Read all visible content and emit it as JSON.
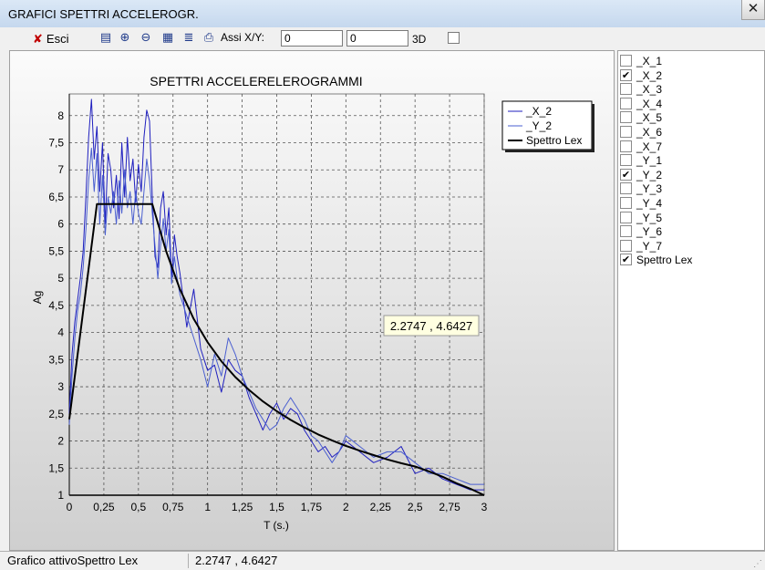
{
  "window": {
    "title": "GRAFICI SPETTRI ACCELEROGR.",
    "close_glyph": "✕"
  },
  "toolbar": {
    "exit_label": "Esci",
    "axes_label": "Assi X/Y:",
    "axis_x_value": "0",
    "axis_y_value": "0",
    "label_3d": "3D",
    "icons": [
      "save-icon",
      "zoom-in-icon",
      "zoom-out-icon",
      "copy-icon",
      "layers-icon",
      "print-icon"
    ]
  },
  "series_list": [
    {
      "label": "_X_1",
      "checked": false
    },
    {
      "label": "_X_2",
      "checked": true
    },
    {
      "label": "_X_3",
      "checked": false
    },
    {
      "label": "_X_4",
      "checked": false
    },
    {
      "label": "_X_5",
      "checked": false
    },
    {
      "label": "_X_6",
      "checked": false
    },
    {
      "label": "_X_7",
      "checked": false
    },
    {
      "label": "_Y_1",
      "checked": false
    },
    {
      "label": "_Y_2",
      "checked": true
    },
    {
      "label": "_Y_3",
      "checked": false
    },
    {
      "label": "_Y_4",
      "checked": false
    },
    {
      "label": "_Y_5",
      "checked": false
    },
    {
      "label": "_Y_6",
      "checked": false
    },
    {
      "label": "_Y_7",
      "checked": false
    },
    {
      "label": "Spettro Lex",
      "checked": true
    }
  ],
  "status": {
    "active_chart": "Grafico attivoSpettro Lex",
    "coords": "2.2747 , 4.6427"
  },
  "chart_data": {
    "type": "line",
    "title": "SPETTRI ACCELERELEROGRAMMI",
    "xlabel": "T (s.)",
    "ylabel": "Ag",
    "xlim": [
      0,
      3
    ],
    "ylim": [
      1,
      8.4
    ],
    "x_ticks": [
      0,
      0.25,
      0.5,
      0.75,
      1,
      1.25,
      1.5,
      1.75,
      2,
      2.25,
      2.5,
      2.75,
      3
    ],
    "x_tick_labels": [
      "0",
      "0,25",
      "0,5",
      "0,75",
      "1",
      "1,25",
      "1,5",
      "1,75",
      "2",
      "2,25",
      "2,5",
      "2,75",
      "3"
    ],
    "y_ticks": [
      1,
      1.5,
      2,
      2.5,
      3,
      3.5,
      4,
      4.5,
      5,
      5.5,
      6,
      6.5,
      7,
      7.5,
      8
    ],
    "y_tick_labels": [
      "1",
      "1,5",
      "2",
      "2,5",
      "3",
      "3,5",
      "4",
      "4,5",
      "5",
      "5,5",
      "6",
      "6,5",
      "7",
      "7,5",
      "8"
    ],
    "grid": true,
    "legend_position": "top-right",
    "tooltip": "2.2747 , 4.6427",
    "series": [
      {
        "name": "_X_2",
        "color": "#1f1fbf",
        "x": [
          0,
          0.02,
          0.04,
          0.06,
          0.08,
          0.1,
          0.12,
          0.14,
          0.16,
          0.18,
          0.2,
          0.22,
          0.24,
          0.26,
          0.28,
          0.3,
          0.32,
          0.34,
          0.36,
          0.38,
          0.4,
          0.42,
          0.44,
          0.46,
          0.48,
          0.5,
          0.52,
          0.54,
          0.56,
          0.58,
          0.6,
          0.62,
          0.64,
          0.66,
          0.68,
          0.7,
          0.72,
          0.74,
          0.76,
          0.78,
          0.8,
          0.85,
          0.9,
          0.95,
          1,
          1.05,
          1.1,
          1.15,
          1.2,
          1.25,
          1.3,
          1.35,
          1.4,
          1.45,
          1.5,
          1.55,
          1.6,
          1.65,
          1.7,
          1.75,
          1.8,
          1.85,
          1.9,
          1.95,
          2,
          2.1,
          2.2,
          2.3,
          2.4,
          2.5,
          2.6,
          2.7,
          2.8,
          2.9,
          3
        ],
        "values": [
          2.5,
          3.6,
          4.2,
          4.6,
          5.0,
          5.5,
          6.5,
          7.6,
          8.3,
          7.2,
          7.8,
          6.6,
          7.5,
          6.0,
          7.3,
          7.0,
          6.3,
          6.9,
          6.1,
          7.5,
          6.5,
          7.6,
          6.8,
          7.2,
          6.4,
          7.1,
          6.6,
          7.6,
          8.1,
          7.9,
          6.5,
          5.4,
          5.2,
          6.3,
          6.6,
          5.8,
          6.3,
          5.0,
          5.8,
          5.4,
          5.1,
          4.1,
          4.8,
          3.7,
          3.3,
          3.4,
          2.9,
          3.5,
          3.3,
          3.2,
          2.8,
          2.5,
          2.2,
          2.5,
          2.7,
          2.4,
          2.6,
          2.5,
          2.2,
          2.0,
          1.8,
          1.9,
          1.7,
          1.8,
          2.0,
          1.8,
          1.6,
          1.7,
          1.9,
          1.4,
          1.5,
          1.3,
          1.2,
          1.1,
          1.1
        ]
      },
      {
        "name": "_Y_2",
        "color": "#4a5fd0",
        "x": [
          0,
          0.02,
          0.04,
          0.06,
          0.08,
          0.1,
          0.12,
          0.14,
          0.16,
          0.18,
          0.2,
          0.22,
          0.24,
          0.26,
          0.28,
          0.3,
          0.32,
          0.34,
          0.36,
          0.38,
          0.4,
          0.42,
          0.44,
          0.46,
          0.48,
          0.5,
          0.52,
          0.54,
          0.56,
          0.58,
          0.6,
          0.62,
          0.64,
          0.66,
          0.68,
          0.7,
          0.72,
          0.74,
          0.76,
          0.78,
          0.8,
          0.85,
          0.9,
          0.95,
          1,
          1.05,
          1.1,
          1.15,
          1.2,
          1.25,
          1.3,
          1.35,
          1.4,
          1.45,
          1.5,
          1.55,
          1.6,
          1.65,
          1.7,
          1.75,
          1.8,
          1.85,
          1.9,
          1.95,
          2,
          2.1,
          2.2,
          2.3,
          2.4,
          2.5,
          2.6,
          2.7,
          2.8,
          2.9,
          3
        ],
        "values": [
          2.3,
          3.2,
          3.9,
          4.4,
          4.7,
          5.2,
          5.9,
          6.8,
          7.4,
          6.6,
          7.3,
          6.0,
          6.9,
          5.8,
          6.5,
          6.2,
          6.6,
          6.0,
          6.8,
          6.2,
          7.0,
          6.3,
          6.6,
          6.0,
          6.6,
          6.2,
          6.0,
          6.6,
          7.2,
          6.8,
          6.2,
          5.6,
          5.0,
          5.6,
          6.1,
          5.5,
          5.9,
          4.9,
          5.4,
          5.0,
          4.7,
          4.3,
          3.9,
          3.5,
          3.0,
          3.6,
          3.2,
          3.9,
          3.6,
          3.2,
          2.9,
          2.6,
          2.4,
          2.2,
          2.3,
          2.6,
          2.8,
          2.6,
          2.4,
          2.1,
          2.0,
          1.8,
          1.6,
          1.8,
          2.1,
          1.9,
          1.7,
          1.8,
          1.8,
          1.6,
          1.4,
          1.4,
          1.3,
          1.2,
          1.2
        ]
      },
      {
        "name": "Spettro Lex",
        "color": "#000000",
        "x": [
          0,
          0.2,
          0.6,
          0.7,
          0.8,
          0.9,
          1.0,
          1.1,
          1.2,
          1.3,
          1.4,
          1.5,
          1.6,
          1.7,
          1.8,
          1.9,
          2.0,
          2.1,
          2.2,
          2.3,
          2.4,
          2.5,
          2.6,
          2.7,
          2.8,
          2.9,
          3.0
        ],
        "values": [
          2.4,
          6.37,
          6.37,
          5.5,
          4.8,
          4.25,
          3.82,
          3.47,
          3.18,
          2.94,
          2.73,
          2.55,
          2.39,
          2.25,
          2.12,
          2.01,
          1.91,
          1.82,
          1.74,
          1.66,
          1.59,
          1.53,
          1.44,
          1.34,
          1.22,
          1.12,
          1.0
        ]
      }
    ]
  }
}
